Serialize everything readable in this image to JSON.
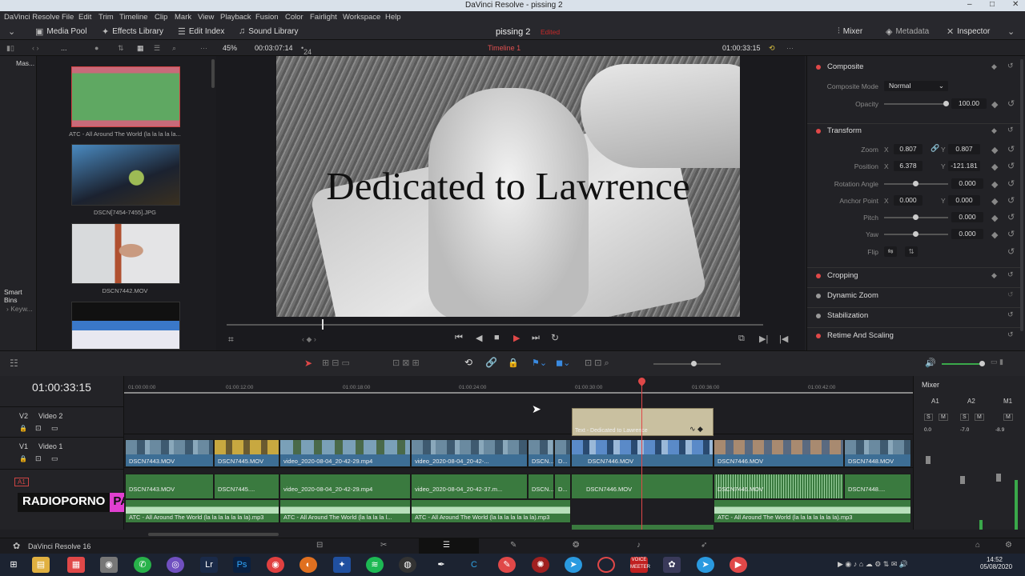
{
  "window": {
    "title": "DaVinci Resolve - pissing 2",
    "controls": [
      "‒",
      "□",
      "✕"
    ]
  },
  "menu": [
    "DaVinci Resolve",
    "File",
    "Edit",
    "Trim",
    "Timeline",
    "Clip",
    "Mark",
    "View",
    "Playback",
    "Fusion",
    "Color",
    "Fairlight",
    "Workspace",
    "Help"
  ],
  "toolbar": {
    "media_pool": "Media Pool",
    "effects_library": "Effects Library",
    "edit_index": "Edit Index",
    "sound_library": "Sound Library",
    "project_name": "pissing 2",
    "edited": "Edited",
    "mixer": "Mixer",
    "metadata": "Metadata",
    "inspector": "Inspector"
  },
  "subbar": {
    "zoom": "45%",
    "duration": "00:03:07:14",
    "fps": "24",
    "timeline_name": "Timeline 1",
    "timecode": "01:00:33:15",
    "ellipsis": "..."
  },
  "left": {
    "master": "Mas...",
    "smart_bins": "Smart Bins",
    "keywords": "Keyw..."
  },
  "media_pool": {
    "items": [
      {
        "label": "ATC - All Around The World (la la la la la..."
      },
      {
        "label": "DSCN[7454-7455].JPG"
      },
      {
        "label": "DSCN7442.MOV"
      }
    ]
  },
  "viewer": {
    "overlay_text": "Dedicated to Lawrence"
  },
  "inspector": {
    "composite": "Composite",
    "composite_mode_label": "Composite Mode",
    "composite_mode": "Normal",
    "opacity_label": "Opacity",
    "opacity": "100.00",
    "transform": "Transform",
    "zoom_label": "Zoom",
    "zoom_x": "0.807",
    "zoom_y": "0.807",
    "position_label": "Position",
    "pos_x": "6.378",
    "pos_y": "-121.181",
    "rotation_label": "Rotation Angle",
    "rotation": "0.000",
    "anchor_label": "Anchor Point",
    "anchor_x": "0.000",
    "anchor_y": "0.000",
    "pitch_label": "Pitch",
    "pitch": "0.000",
    "yaw_label": "Yaw",
    "yaw": "0.000",
    "flip_label": "Flip",
    "x": "X",
    "y": "Y",
    "cropping": "Cropping",
    "dynamic_zoom": "Dynamic Zoom",
    "stabilization": "Stabilization",
    "retime": "Retime And Scaling"
  },
  "timeline": {
    "timecode": "01:00:33:15",
    "ruler": [
      "01:00:00:00",
      "01:00:12:00",
      "01:00:18:00",
      "01:00:24:00",
      "01:00:30:00",
      "01:00:36:00",
      "01:00:42:00"
    ],
    "tracks": {
      "v2": {
        "id": "V2",
        "name": "Video 2"
      },
      "v1": {
        "id": "V1",
        "name": "Video 1"
      },
      "a1": {
        "id": "A1"
      }
    },
    "title_clip": "Text - Dedicated to Lawrence",
    "video_clips": [
      "DSCN7443.MOV",
      "DSCN7445.MOV",
      "video_2020-08-04_20-42-29.mp4",
      "video_2020-08-04_20-42-...",
      "DSCN...",
      "D...",
      "DSCN7446.MOV",
      "DSCN7446.MOV",
      "DSCN7448.MOV"
    ],
    "audio_clips": [
      "DSCN7443.MOV",
      "DSCN7445....",
      "video_2020-08-04_20-42-29.mp4",
      "video_2020-08-04_20-42-37.m...",
      "DSCN...",
      "D...",
      "DSCN7446.MOV",
      "DSCN7446.MOV",
      "DSCN7448...."
    ],
    "music_clips": [
      "ATC - All Around The World (la la la la la la la).mp3",
      "ATC - All Around The World (la la la la l...",
      "ATC - All Around The World (la la la la la la la).mp3",
      "ATC - All Around The World (la la la la la la la).mp3"
    ]
  },
  "mixer": {
    "title": "Mixer",
    "channels": [
      "A1",
      "A2",
      "M1"
    ],
    "s": "S",
    "m": "M",
    "a1_level": "0.0",
    "a2_level": "-7.0",
    "m1_level": "-8.9"
  },
  "watermark": {
    "part1": "RADIOPORNO",
    "part2": "PANDA"
  },
  "status": {
    "app": "DaVinci Resolve 16"
  },
  "taskbar": {
    "time": "14:52",
    "date": "05/08/2020",
    "voicemeeter": "VOICE MEETER"
  }
}
